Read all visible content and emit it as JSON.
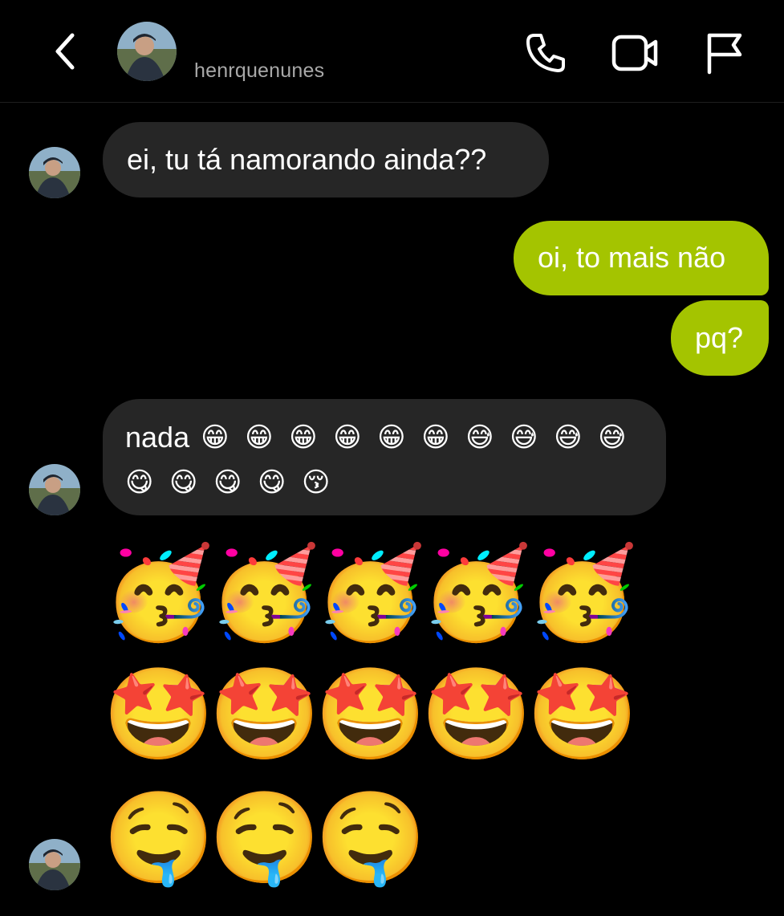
{
  "header": {
    "username": "henrquenunes",
    "back_icon": "chevron-left-icon",
    "call_icon": "phone-icon",
    "video_icon": "video-camera-icon",
    "report_icon": "flag-icon"
  },
  "colors": {
    "background": "#000000",
    "incoming_bubble": "#262626",
    "outgoing_bubble": "#a4c400",
    "username_text": "#a8a8a8"
  },
  "messages": [
    {
      "side": "incoming",
      "text": "ei, tu tá namorando ainda??"
    },
    {
      "side": "outgoing",
      "text": "oi, to mais não"
    },
    {
      "side": "outgoing",
      "text": "pq?"
    },
    {
      "side": "incoming",
      "text": "nada",
      "emoji_line1": [
        "😁",
        "😁",
        "😁",
        "😁",
        "😁",
        "😁",
        "😅",
        "😅",
        "😅",
        "😅"
      ],
      "emoji_line2": [
        "😋",
        "😋",
        "😋",
        "😋",
        "😚"
      ]
    }
  ],
  "big_emoji_rows": [
    [
      "🥳",
      "🥳",
      "🥳",
      "🥳",
      "🥳"
    ],
    [
      "🤩",
      "🤩",
      "🤩",
      "🤩",
      "🤩"
    ],
    [
      "🤤",
      "🤤",
      "🤤"
    ]
  ]
}
